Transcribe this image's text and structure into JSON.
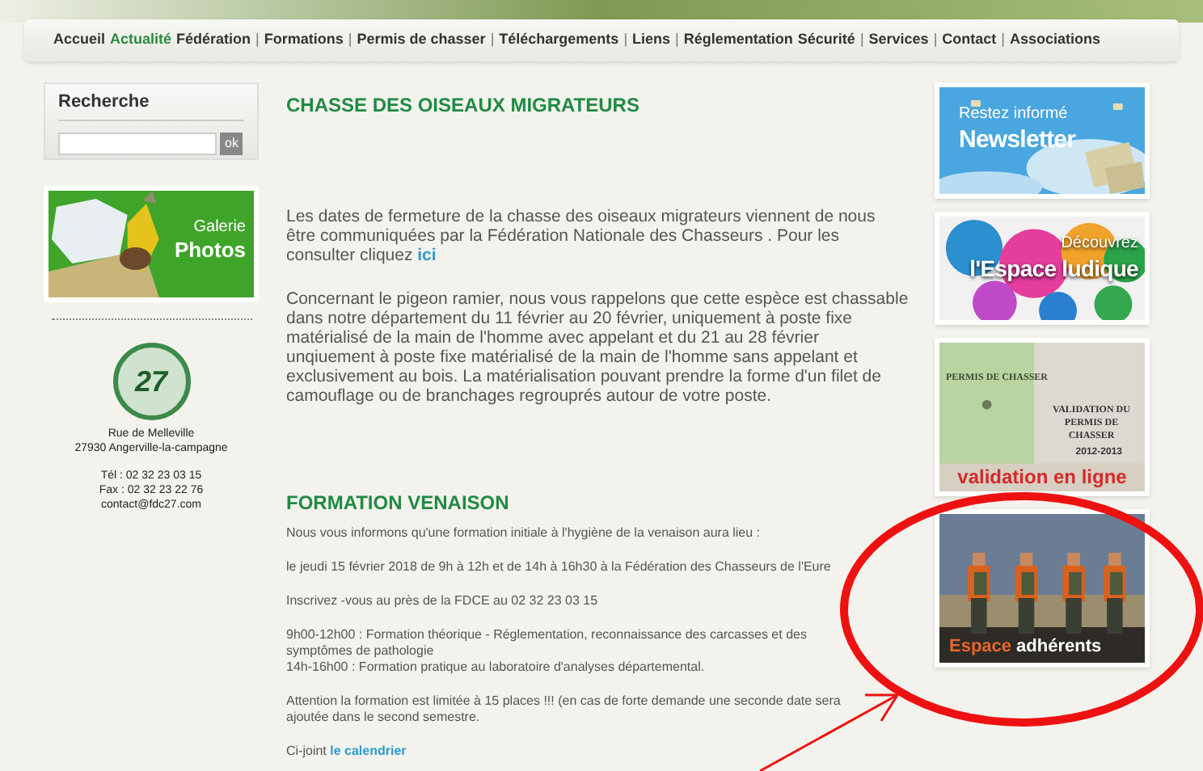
{
  "nav": [
    {
      "kind": "link",
      "label": "Accueil",
      "selected": false
    },
    {
      "kind": "link",
      "label": "Actualité",
      "selected": true
    },
    {
      "kind": "link",
      "label": "Fédération",
      "selected": false
    },
    {
      "kind": "separator",
      "label": "|"
    },
    {
      "kind": "link",
      "label": "Formations",
      "selected": false
    },
    {
      "kind": "separator",
      "label": "|"
    },
    {
      "kind": "link",
      "label": "Permis de chasser",
      "selected": false
    },
    {
      "kind": "separator",
      "label": "|"
    },
    {
      "kind": "link",
      "label": "Téléchargements",
      "selected": false
    },
    {
      "kind": "separator",
      "label": "|"
    },
    {
      "kind": "link",
      "label": "Liens",
      "selected": false
    },
    {
      "kind": "separator",
      "label": "|"
    },
    {
      "kind": "link",
      "label": "Réglementation",
      "selected": false
    },
    {
      "kind": "link",
      "label": "Sécurité",
      "selected": false
    },
    {
      "kind": "separator",
      "label": "|"
    },
    {
      "kind": "link",
      "label": "Services",
      "selected": false
    },
    {
      "kind": "separator",
      "label": "|"
    },
    {
      "kind": "link",
      "label": "Contact",
      "selected": false
    },
    {
      "kind": "separator",
      "label": "|"
    },
    {
      "kind": "link",
      "label": "Associations",
      "selected": false
    }
  ],
  "search": {
    "title": "Recherche",
    "button": "ok"
  },
  "gallery_banner": {
    "line1": "Galerie",
    "line2": "Photos"
  },
  "logo": {
    "text": "27"
  },
  "address": {
    "lines": [
      "Rue de Melleville",
      "27930 Angerville-la-campagne"
    ],
    "contact": [
      "Tél : 02 32 23 03 15",
      "Fax : 02 32 23 22 76",
      "contact@fdc27.com"
    ]
  },
  "articles": [
    {
      "title": "CHASSE DES OISEAUX MIGRATEURS",
      "paragraphs": [
        {
          "text": "Les dates de fermeture de la chasse des oiseaux migrateurs viennent de nous être communiquées par la Fédération Nationale des Chasseurs . Pour les consulter cliquez ",
          "link": "ici"
        },
        {
          "text": "Concernant le pigeon ramier, nous vous rappelons que cette espèce est chassable dans notre département du 11 février au 20 février, uniquement à poste fixe matérialisé de la main de l'homme avec appelant et du 21 au 28 février unqiuement à poste fixe matérialisé de la main de l'homme sans appelant et exclusivement au bois. La matérialisation pouvant prendre la forme d'un filet de camouflage ou de branchages regrouprés autour de votre poste."
        }
      ]
    },
    {
      "title": "FORMATION VENAISON",
      "paragraphs": [
        {
          "text": "Nous vous informons qu'une formation initiale à l'hygiène de la venaison aura lieu :"
        },
        {
          "text": "le jeudi 15 février 2018 de 9h à 12h et de 14h à 16h30 à la Fédération des Chasseurs de l'Eure"
        },
        {
          "text": "Inscrivez -vous au près de la FDCE au 02 32 23 03 15"
        },
        {
          "text": "9h00-12h00 : Formation théorique - Réglementation, reconnaissance des carcasses et des symptômes de pathologie"
        },
        {
          "text": "14h-16h00 : Formation pratique au laboratoire d'analyses départemental."
        },
        {
          "text": "Attention la formation est limitée à 15 places !!! (en cas de forte demande une seconde date sera ajoutée dans le second semestre."
        },
        {
          "text": "Ci-joint ",
          "link": "le calendrier"
        }
      ]
    }
  ],
  "banners": [
    {
      "kind": "newsletter",
      "line1": "Restez informé",
      "line2": "Newsletter"
    },
    {
      "kind": "ludique",
      "line1": "Découvrez",
      "line2": "l'Espace ludique"
    },
    {
      "kind": "validation",
      "doc": "PERMIS DE CHASSER",
      "heading": "VALIDATION DU PERMIS DE CHASSER",
      "years": "2012-2013",
      "line2": "validation en ligne"
    },
    {
      "kind": "adherents",
      "word1": "Espace",
      "word2": "adhérents"
    }
  ]
}
